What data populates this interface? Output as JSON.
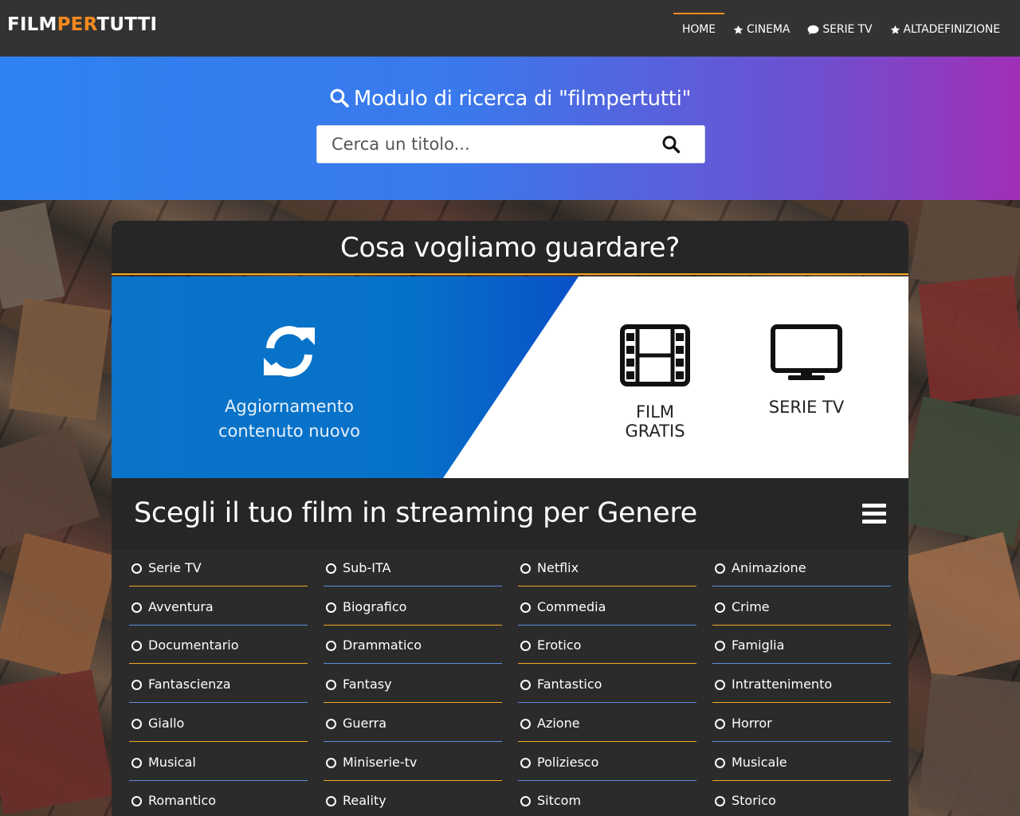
{
  "brand": {
    "logo_part1": "FILM",
    "logo_part2": "PER",
    "logo_part3": "TUTTI",
    "accent_color": "#f58a1f"
  },
  "nav": {
    "items": [
      {
        "label": "HOME",
        "icon": "none",
        "active": true
      },
      {
        "label": "CINEMA",
        "icon": "star-icon",
        "active": false
      },
      {
        "label": "SERIE TV",
        "icon": "comment-icon",
        "active": false
      },
      {
        "label": "ALTADEFINIZIONE",
        "icon": "star-icon",
        "active": false
      }
    ]
  },
  "search": {
    "title": "Modulo di ricerca di \"filmpertutti\"",
    "placeholder": "Cerca un titolo..."
  },
  "panel": {
    "heading": "Cosa vogliamo guardare?",
    "update_line1": "Aggiornamento",
    "update_line2": "contenuto nuovo",
    "film_label": "FILM GRATIS",
    "series_label": "SERIE TV"
  },
  "genres": {
    "heading": "Scegli il tuo film in streaming per Genere",
    "rows": [
      [
        "Serie TV",
        "Sub-ITA",
        "Netflix",
        "Animazione"
      ],
      [
        "Avventura",
        "Biografico",
        "Commedia",
        "Crime"
      ],
      [
        "Documentario",
        "Drammatico",
        "Erotico",
        "Famiglia"
      ],
      [
        "Fantascienza",
        "Fantasy",
        "Fantastico",
        "Intrattenimento"
      ],
      [
        "Giallo",
        "Guerra",
        "Azione",
        "Horror"
      ],
      [
        "Musical",
        "Miniserie-tv",
        "Poliziesco",
        "Musicale"
      ],
      [
        "Romantico",
        "Reality",
        "Sitcom",
        "Storico"
      ]
    ]
  }
}
